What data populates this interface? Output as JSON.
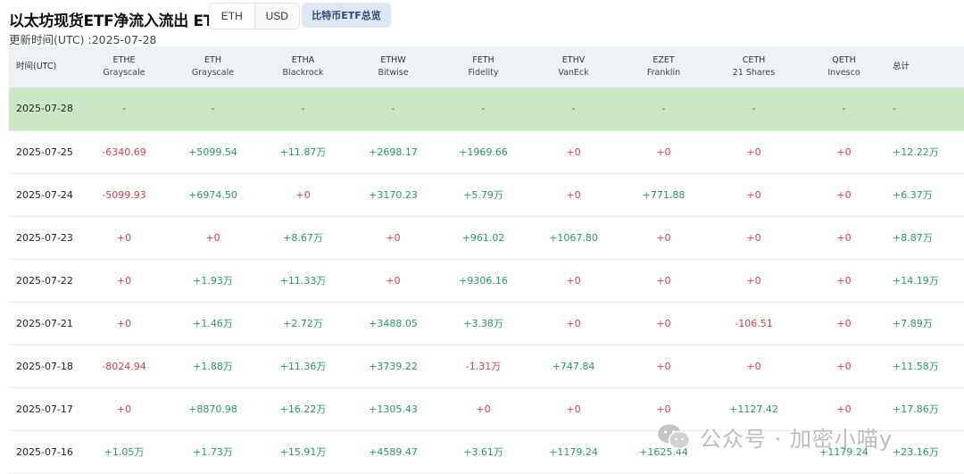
{
  "header": {
    "title": "以太坊现货ETF净流入流出 ETH",
    "toggle": [
      "ETH",
      "USD"
    ],
    "overview_button": "比特币ETF总览",
    "updated": "更新时间(UTC) :2025-07-28"
  },
  "table": {
    "time_header": "时间(UTC)",
    "total_header": "总计",
    "funds": [
      {
        "code": "ETHE",
        "issuer": "Grayscale"
      },
      {
        "code": "ETH",
        "issuer": "Grayscale"
      },
      {
        "code": "ETHA",
        "issuer": "Blackrock"
      },
      {
        "code": "ETHW",
        "issuer": "Bitwise"
      },
      {
        "code": "FETH",
        "issuer": "Fidelity"
      },
      {
        "code": "ETHV",
        "issuer": "VanEck"
      },
      {
        "code": "EZET",
        "issuer": "Franklin"
      },
      {
        "code": "CETH",
        "issuer": "21 Shares"
      },
      {
        "code": "QETH",
        "issuer": "Invesco"
      }
    ],
    "rows": [
      {
        "date": "2025-07-28",
        "values": [
          "-",
          "-",
          "-",
          "-",
          "-",
          "-",
          "-",
          "-",
          "-"
        ],
        "total": "-"
      },
      {
        "date": "2025-07-25",
        "values": [
          "-6340.69",
          "+5099.54",
          "+11.87万",
          "+2698.17",
          "+1969.66",
          "+0",
          "+0",
          "+0",
          "+0"
        ],
        "total": "+12.22万"
      },
      {
        "date": "2025-07-24",
        "values": [
          "-5099.93",
          "+6974.50",
          "+0",
          "+3170.23",
          "+5.79万",
          "+0",
          "+771.88",
          "+0",
          "+0"
        ],
        "total": "+6.37万"
      },
      {
        "date": "2025-07-23",
        "values": [
          "+0",
          "+0",
          "+8.67万",
          "+0",
          "+961.02",
          "+1067.80",
          "+0",
          "+0",
          "+0"
        ],
        "total": "+8.87万"
      },
      {
        "date": "2025-07-22",
        "values": [
          "+0",
          "+1.93万",
          "+11.33万",
          "+0",
          "+9306.16",
          "+0",
          "+0",
          "+0",
          "+0"
        ],
        "total": "+14.19万"
      },
      {
        "date": "2025-07-21",
        "values": [
          "+0",
          "+1.46万",
          "+2.72万",
          "+3488.05",
          "+3.38万",
          "+0",
          "+0",
          "-106.51",
          "+0"
        ],
        "total": "+7.89万"
      },
      {
        "date": "2025-07-18",
        "values": [
          "-8024.94",
          "+1.88万",
          "+11.36万",
          "+3739.22",
          "-1.31万",
          "+747.84",
          "+0",
          "+0",
          "+0"
        ],
        "total": "+11.58万"
      },
      {
        "date": "2025-07-17",
        "values": [
          "+0",
          "+8870.98",
          "+16.22万",
          "+1305.43",
          "+0",
          "+0",
          "+0",
          "+1127.42",
          "+0"
        ],
        "total": "+17.86万"
      },
      {
        "date": "2025-07-16",
        "values": [
          "+1.05万",
          "+1.73万",
          "+15.91万",
          "+4589.47",
          "+3.61万",
          "+1179.24",
          "+1625.44",
          "",
          "+1179.24"
        ],
        "total": "+23.16万"
      }
    ]
  },
  "watermark": "公众号 · 加密小喵y",
  "colors": {
    "positive": "#1f9a73",
    "negative": "#e2394a",
    "highlight_row": "#cbe7c6",
    "header_bg": "#eef1f5"
  }
}
